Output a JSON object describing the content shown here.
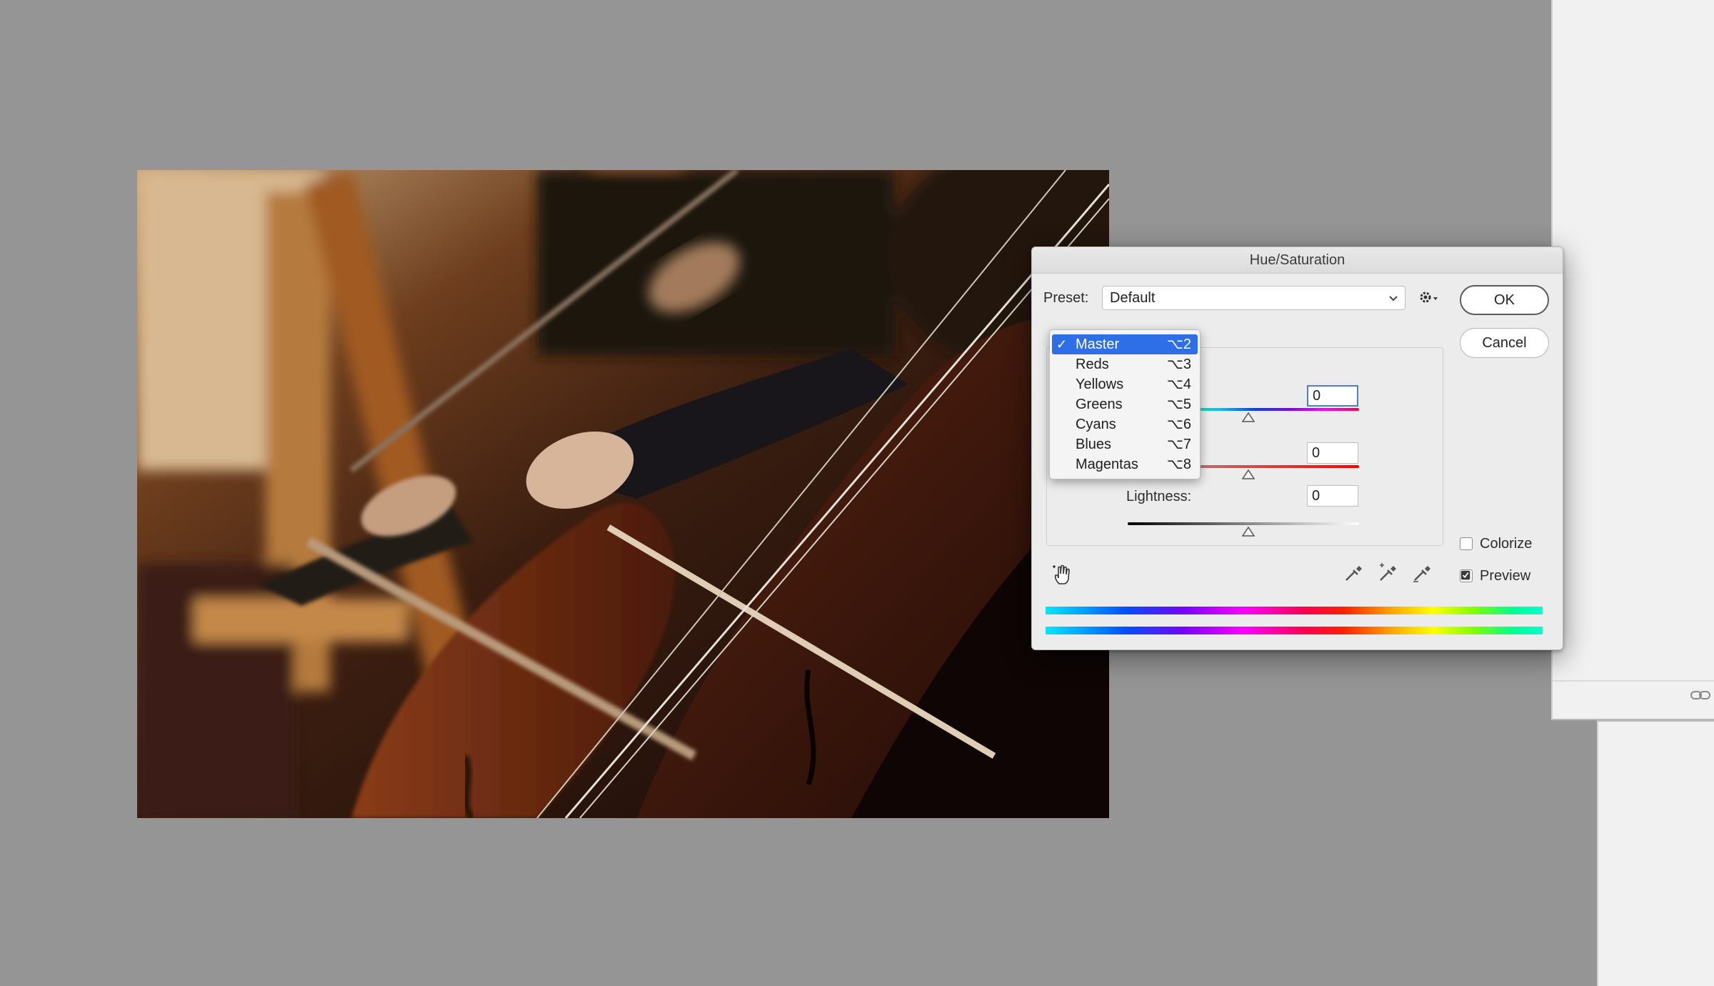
{
  "dialog": {
    "title": "Hue/Saturation",
    "preset_label": "Preset:",
    "preset_value": "Default",
    "ok_label": "OK",
    "cancel_label": "Cancel",
    "hue_value": "0",
    "saturation_value": "0",
    "lightness_label": "Lightness:",
    "lightness_value": "0",
    "colorize_label": "Colorize",
    "colorize_checked": false,
    "preview_label": "Preview",
    "preview_checked": true
  },
  "channel_menu": {
    "items": [
      {
        "label": "Master",
        "shortcut": "⌥2",
        "selected": true
      },
      {
        "label": "Reds",
        "shortcut": "⌥3",
        "selected": false
      },
      {
        "label": "Yellows",
        "shortcut": "⌥4",
        "selected": false
      },
      {
        "label": "Greens",
        "shortcut": "⌥5",
        "selected": false
      },
      {
        "label": "Cyans",
        "shortcut": "⌥6",
        "selected": false
      },
      {
        "label": "Blues",
        "shortcut": "⌥7",
        "selected": false
      },
      {
        "label": "Magentas",
        "shortcut": "⌥8",
        "selected": false
      }
    ],
    "check_mark": "✓"
  },
  "icons": {
    "gear": "gear-icon",
    "hand": "hand-adjust-icon",
    "eyedropper": "eyedropper-icon",
    "eyedropper_add": "eyedropper-plus-icon",
    "eyedropper_subtract": "eyedropper-minus-icon",
    "link": "link-icon",
    "chevron": "chevron-down-icon"
  },
  "colors": {
    "canvas_bg": "#959595",
    "accent": "#2e6ee6",
    "dialog_bg": "#ececec"
  }
}
